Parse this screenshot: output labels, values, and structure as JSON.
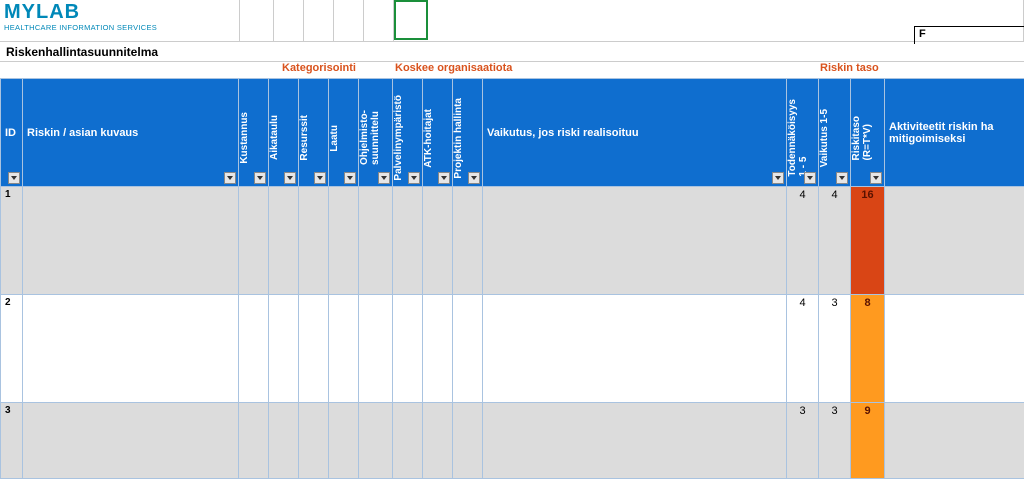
{
  "logo": {
    "main": "MYLAB",
    "sub": "HEALTHCARE INFORMATION SERVICES"
  },
  "title": "Riskenhallintasuunnitelma",
  "corner": "F",
  "groups": {
    "kategorisointi": "Kategorisointi",
    "koskee": "Koskee organisaatiota",
    "taso": "Riskin taso"
  },
  "headers": {
    "id": "ID",
    "kuvaus": "Riskin / asian kuvaus",
    "kustannus": "Kustannus",
    "aikataulu": "Aikataulu",
    "resurssit": "Resurssit",
    "laatu": "Laatu",
    "ohjelmisto": "Ohjelmisto-\nsuunnittelu",
    "palvelin": "Palvelinympäristö",
    "atk": "ATK-hoitajat",
    "projhal": "Projektin hallinta",
    "vaikutus": "Vaikutus, jos riski realisoituu",
    "todenn": "Todennäköisyys\n1 - 5",
    "vaik15": "Vaikutus 1-5",
    "riskitaso": "Riskitaso\n(R=T*V)",
    "aktiviteetit": "Aktiviteetit riskin ha\nmitigoimiseksi"
  },
  "rows": [
    {
      "id": "1",
      "todenn": "4",
      "vaik": "4",
      "taso": "16",
      "cls": "r16",
      "bg": "grey"
    },
    {
      "id": "2",
      "todenn": "4",
      "vaik": "3",
      "taso": "8",
      "cls": "r8",
      "bg": "white"
    },
    {
      "id": "3",
      "todenn": "3",
      "vaik": "3",
      "taso": "9",
      "cls": "r9",
      "bg": "grey",
      "short": true
    }
  ]
}
